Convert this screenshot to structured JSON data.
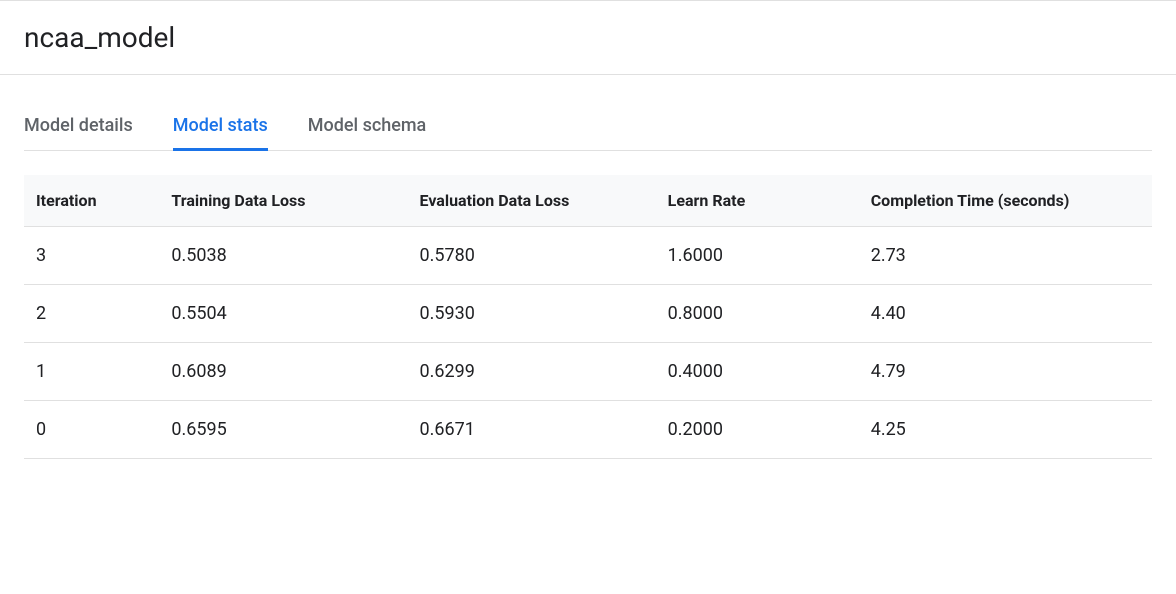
{
  "header": {
    "title": "ncaa_model"
  },
  "tabs": [
    {
      "label": "Model details",
      "active": false
    },
    {
      "label": "Model stats",
      "active": true
    },
    {
      "label": "Model schema",
      "active": false
    }
  ],
  "table": {
    "headers": {
      "iteration": "Iteration",
      "training_loss": "Training Data Loss",
      "eval_loss": "Evaluation Data Loss",
      "learn_rate": "Learn Rate",
      "completion_time": "Completion Time (seconds)"
    },
    "rows": [
      {
        "iteration": "3",
        "training_loss": "0.5038",
        "eval_loss": "0.5780",
        "learn_rate": "1.6000",
        "completion_time": "2.73"
      },
      {
        "iteration": "2",
        "training_loss": "0.5504",
        "eval_loss": "0.5930",
        "learn_rate": "0.8000",
        "completion_time": "4.40"
      },
      {
        "iteration": "1",
        "training_loss": "0.6089",
        "eval_loss": "0.6299",
        "learn_rate": "0.4000",
        "completion_time": "4.79"
      },
      {
        "iteration": "0",
        "training_loss": "0.6595",
        "eval_loss": "0.6671",
        "learn_rate": "0.2000",
        "completion_time": "4.25"
      }
    ]
  }
}
